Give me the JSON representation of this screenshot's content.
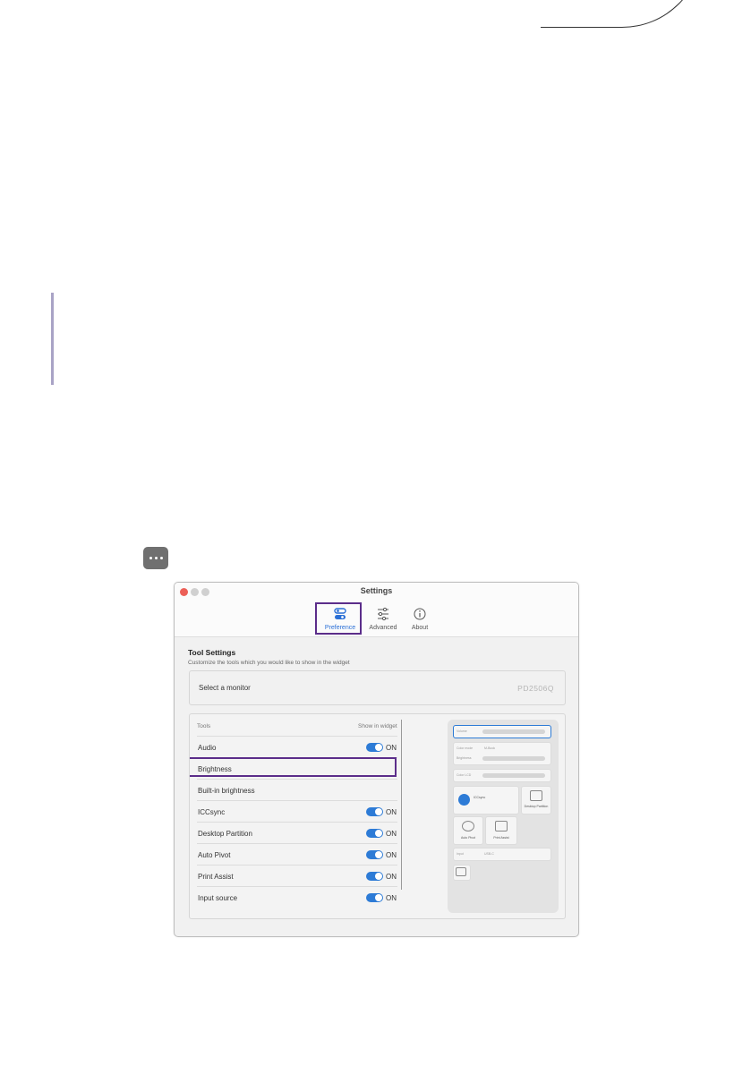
{
  "window": {
    "title": "Settings",
    "tabs": [
      {
        "label": "Preference",
        "icon": "toggles-icon"
      },
      {
        "label": "Advanced",
        "icon": "sliders-icon"
      },
      {
        "label": "About",
        "icon": "info-icon"
      }
    ]
  },
  "tool_settings": {
    "title": "Tool Settings",
    "subtitle": "Customize the tools which you would like to show in the widget",
    "monitor": {
      "label": "Select a monitor",
      "value": "PD2506Q"
    },
    "header_tools": "Tools",
    "header_show": "Show in widget",
    "rows": [
      {
        "name": "Audio",
        "on": true,
        "state": "ON"
      },
      {
        "name": "Brightness",
        "on": false,
        "state": ""
      },
      {
        "name": "Built-in brightness",
        "on": false,
        "state": ""
      },
      {
        "name": "ICCsync",
        "on": true,
        "state": "ON"
      },
      {
        "name": "Desktop Partition",
        "on": true,
        "state": "ON"
      },
      {
        "name": "Auto Pivot",
        "on": true,
        "state": "ON"
      },
      {
        "name": "Print Assist",
        "on": true,
        "state": "ON"
      },
      {
        "name": "Input source",
        "on": true,
        "state": "ON"
      }
    ]
  },
  "preview": {
    "volume": "Volume",
    "color_mode": "Color mode",
    "color_mode_value": "M-Book",
    "brightness": "Brightness",
    "color_lcd": "Color LCD",
    "iccsync": "ICCsync",
    "desktop_partition": "Desktop Partition",
    "auto_pivot": "Auto Pivot",
    "print_assist": "Print Assist",
    "input": "Input",
    "input_value": "USB-C"
  },
  "colors": {
    "accent": "#2d7bd6",
    "highlight": "#5b2d8a",
    "close": "#ec5f57"
  }
}
